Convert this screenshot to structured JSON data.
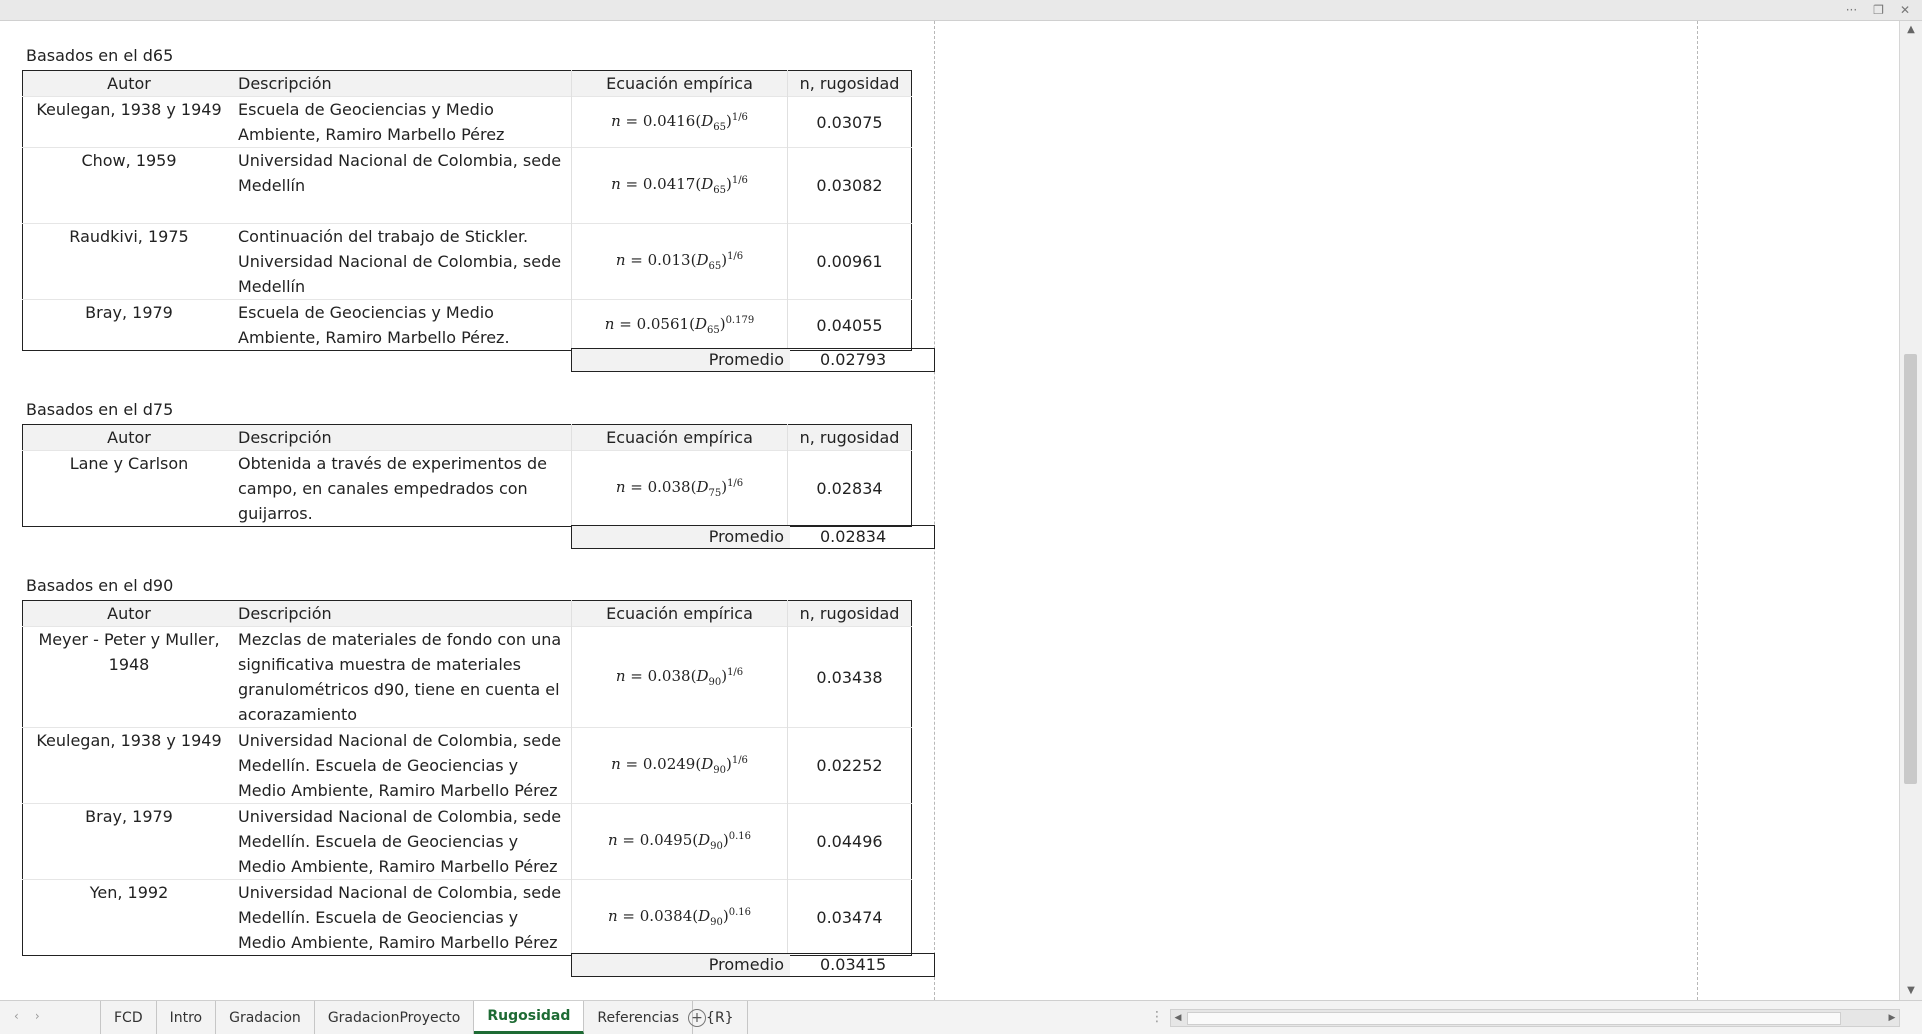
{
  "window": {
    "more_icon": "more-dots-icon",
    "restore_icon": "restore-icon",
    "close_icon": "close-icon",
    "more_glyph": "···",
    "restore_glyph": "❐",
    "close_glyph": "✕"
  },
  "headers": {
    "author": "Autor",
    "desc": "Descripción",
    "eq": "Ecuación empírica",
    "n": "n, rugosidad"
  },
  "avg_label": "Promedio",
  "sections": [
    {
      "title": "Basados en el d65",
      "rows": [
        {
          "author": "Keulegan, 1938 y 1949",
          "desc": "Escuela de Geociencias y Medio Ambiente, Ramiro Marbello Pérez",
          "coef": "0.0416",
          "d": "65",
          "exp": "1/6",
          "n": "0.03075"
        },
        {
          "author": "Chow, 1959",
          "desc": "Universidad Nacional de Colombia, sede Medellín",
          "coef": "0.0417",
          "d": "65",
          "exp": "1/6",
          "n": "0.03082"
        },
        {
          "author": "Raudkivi, 1975",
          "desc": "Continuación del trabajo de Stickler. Universidad Nacional de Colombia, sede Medellín",
          "coef": "0.013",
          "d": "65",
          "exp": "1/6",
          "n": "0.00961"
        },
        {
          "author": "Bray, 1979",
          "desc": "Escuela de Geociencias y Medio Ambiente, Ramiro Marbello Pérez.",
          "coef": "0.0561",
          "d": "65",
          "exp": "0.179",
          "n": "0.04055"
        }
      ],
      "avg": "0.02793"
    },
    {
      "title": "Basados en el d75",
      "rows": [
        {
          "author": "Lane y Carlson",
          "desc": "Obtenida a través de experimentos de campo, en canales empedrados con guijarros.",
          "coef": "0.038",
          "d": "75",
          "exp": "1/6",
          "n": "0.02834"
        }
      ],
      "avg": "0.02834"
    },
    {
      "title": "Basados en el d90",
      "rows": [
        {
          "author": "Meyer - Peter y Muller, 1948",
          "desc": "Mezclas de materiales de fondo con una significativa muestra de materiales granulométricos d90, tiene en cuenta el acorazamiento",
          "coef": "0.038",
          "d": "90",
          "exp": "1/6",
          "n": "0.03438"
        },
        {
          "author": "Keulegan, 1938 y 1949",
          "desc": "Universidad Nacional de Colombia, sede Medellín. Escuela de Geociencias y Medio Ambiente, Ramiro Marbello Pérez",
          "coef": "0.0249",
          "d": "90",
          "exp": "1/6",
          "n": "0.02252"
        },
        {
          "author": "Bray, 1979",
          "desc": "Universidad Nacional de Colombia, sede Medellín. Escuela de Geociencias y Medio Ambiente, Ramiro Marbello Pérez",
          "coef": "0.0495",
          "d": "90",
          "exp": "0.16",
          "n": "0.04496"
        },
        {
          "author": "Yen, 1992",
          "desc": "Universidad Nacional de Colombia, sede Medellín. Escuela de Geociencias y Medio Ambiente, Ramiro Marbello Pérez",
          "coef": "0.0384",
          "d": "90",
          "exp": "0.16",
          "n": "0.03474"
        }
      ],
      "avg": "0.03415"
    }
  ],
  "tabs": [
    "FCD",
    "Intro",
    "Gradacion",
    "GradacionProyecto",
    "Rugosidad",
    "Referencias",
    "{R}"
  ],
  "active_tab": "Rugosidad",
  "tab_nav": {
    "prev": "‹",
    "next": "›"
  },
  "add_sheet": "+",
  "hscroll": {
    "left": "◀",
    "right": "▶"
  },
  "vscroll": {
    "up": "▲",
    "down": "▼"
  }
}
